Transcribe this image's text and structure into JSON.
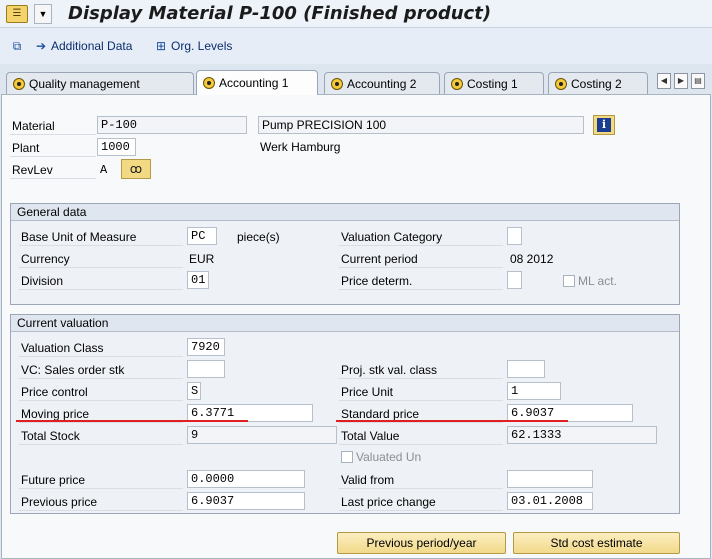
{
  "title": "Display Material P-100 (Finished product)",
  "toolbar": {
    "additional_data": "Additional Data",
    "org_levels": "Org. Levels"
  },
  "tabs": [
    {
      "label": "Quality management"
    },
    {
      "label": "Accounting 1"
    },
    {
      "label": "Accounting 2"
    },
    {
      "label": "Costing 1"
    },
    {
      "label": "Costing 2"
    }
  ],
  "header": {
    "material_label": "Material",
    "material_value": "P-100",
    "material_desc": "Pump PRECISION 100",
    "plant_label": "Plant",
    "plant_value": "1000",
    "plant_desc": "Werk Hamburg",
    "revlev_label": "RevLev",
    "revlev_value": "A"
  },
  "general": {
    "title": "General data",
    "base_uom_label": "Base Unit of Measure",
    "base_uom_value": "PC",
    "base_uom_desc": "piece(s)",
    "valuation_category_label": "Valuation Category",
    "valuation_category_value": "",
    "currency_label": "Currency",
    "currency_value": "EUR",
    "current_period_label": "Current period",
    "current_period_value": "08 2012",
    "division_label": "Division",
    "division_value": "01",
    "price_determ_label": "Price determ.",
    "price_determ_value": "",
    "ml_act_label": "ML act."
  },
  "valuation": {
    "title": "Current valuation",
    "valuation_class_label": "Valuation Class",
    "valuation_class_value": "7920",
    "vc_sales_label": "VC: Sales order stk",
    "vc_sales_value": "",
    "proj_stk_label": "Proj. stk val. class",
    "proj_stk_value": "",
    "price_control_label": "Price control",
    "price_control_value": "S",
    "price_unit_label": "Price Unit",
    "price_unit_value": "1",
    "moving_price_label": "Moving price",
    "moving_price_value": "6.3771",
    "standard_price_label": "Standard price",
    "standard_price_value": "6.9037",
    "total_stock_label": "Total Stock",
    "total_stock_value": "9",
    "total_value_label": "Total Value",
    "total_value_value": "62.1333",
    "valuated_un_label": "Valuated Un",
    "future_price_label": "Future price",
    "future_price_value": "0.0000",
    "valid_from_label": "Valid from",
    "valid_from_value": "",
    "previous_price_label": "Previous price",
    "previous_price_value": "6.9037",
    "last_price_change_label": "Last price change",
    "last_price_change_value": "03.01.2008"
  },
  "buttons": {
    "previous_period": "Previous period/year",
    "std_cost_estimate": "Std cost estimate"
  },
  "colors": {
    "highlight_underline": "#e02020",
    "accent_blue": "#1a3d8f",
    "button_yellow": "#f2d98a"
  }
}
